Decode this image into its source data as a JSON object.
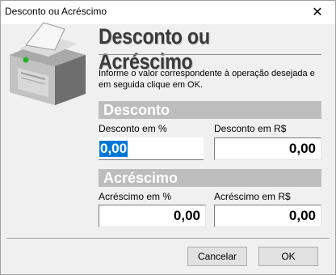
{
  "window": {
    "title": "Desconto ou Acréscimo",
    "close_glyph": "✕"
  },
  "header": {
    "title": "Desconto ou Acréscimo",
    "info": "Informe o valor correspondente à operação desejada e em seguida clique em OK.",
    "icon": "receipt-printer-icon"
  },
  "desconto": {
    "section_label": "Desconto",
    "percent_label": "Desconto em %",
    "percent_value": "0,00",
    "money_label": "Desconto em R$",
    "money_value": "0,00"
  },
  "acrescimo": {
    "section_label": "Acréscimo",
    "percent_label": "Acréscimo em %",
    "percent_value": "0,00",
    "money_label": "Acréscimo em R$",
    "money_value": "0,00"
  },
  "buttons": {
    "cancel": "Cancelar",
    "ok": "OK"
  },
  "colors": {
    "section_bg": "#bdbdbd",
    "selection": "#0078d7",
    "window_bg": "#f0f0f0"
  }
}
